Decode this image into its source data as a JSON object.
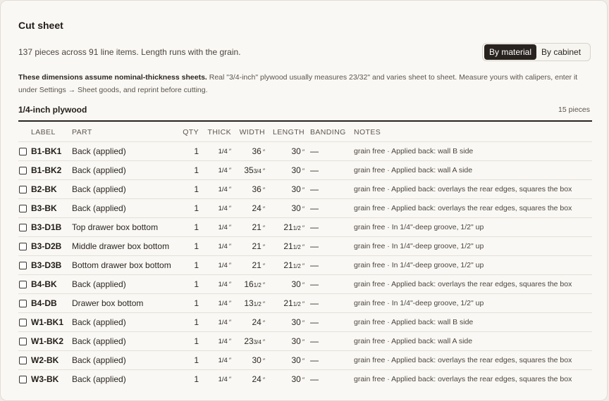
{
  "header": {
    "title": "Cut sheet",
    "summary": "137 pieces across 91 line items. Length runs with the grain.",
    "view_toggle": {
      "options": [
        "By material",
        "By cabinet"
      ],
      "selected": "By material"
    }
  },
  "note": {
    "bold": "These dimensions assume nominal-thickness sheets.",
    "text": " Real \"3/4-inch\" plywood usually measures 23/32\" and varies sheet to sheet. Measure yours with calipers, enter it under Settings → Sheet goods, and reprint before cutting."
  },
  "section": {
    "title": "1/4-inch plywood",
    "count": "15 pieces",
    "columns": [
      "LABEL",
      "PART",
      "QTY",
      "THICK",
      "WIDTH",
      "LENGTH",
      "BANDING",
      "NOTES"
    ],
    "rows": [
      {
        "label": "B1-BK1",
        "part": "Back (applied)",
        "qty": "1",
        "thick": "1/4",
        "width": {
          "w": "36",
          "f": ""
        },
        "length": {
          "w": "30",
          "f": ""
        },
        "banding": "—",
        "notes": "grain free · Applied back: wall B side"
      },
      {
        "label": "B1-BK2",
        "part": "Back (applied)",
        "qty": "1",
        "thick": "1/4",
        "width": {
          "w": "35",
          "f": "3/4"
        },
        "length": {
          "w": "30",
          "f": ""
        },
        "banding": "—",
        "notes": "grain free · Applied back: wall A side"
      },
      {
        "label": "B2-BK",
        "part": "Back (applied)",
        "qty": "1",
        "thick": "1/4",
        "width": {
          "w": "36",
          "f": ""
        },
        "length": {
          "w": "30",
          "f": ""
        },
        "banding": "—",
        "notes": "grain free · Applied back: overlays the rear edges, squares the box"
      },
      {
        "label": "B3-BK",
        "part": "Back (applied)",
        "qty": "1",
        "thick": "1/4",
        "width": {
          "w": "24",
          "f": ""
        },
        "length": {
          "w": "30",
          "f": ""
        },
        "banding": "—",
        "notes": "grain free · Applied back: overlays the rear edges, squares the box"
      },
      {
        "label": "B3-D1B",
        "part": "Top drawer box bottom",
        "qty": "1",
        "thick": "1/4",
        "width": {
          "w": "21",
          "f": ""
        },
        "length": {
          "w": "21",
          "f": "1/2"
        },
        "banding": "—",
        "notes": "grain free · In 1/4\"-deep groove, 1/2\" up"
      },
      {
        "label": "B3-D2B",
        "part": "Middle drawer box bottom",
        "qty": "1",
        "thick": "1/4",
        "width": {
          "w": "21",
          "f": ""
        },
        "length": {
          "w": "21",
          "f": "1/2"
        },
        "banding": "—",
        "notes": "grain free · In 1/4\"-deep groove, 1/2\" up"
      },
      {
        "label": "B3-D3B",
        "part": "Bottom drawer box bottom",
        "qty": "1",
        "thick": "1/4",
        "width": {
          "w": "21",
          "f": ""
        },
        "length": {
          "w": "21",
          "f": "1/2"
        },
        "banding": "—",
        "notes": "grain free · In 1/4\"-deep groove, 1/2\" up"
      },
      {
        "label": "B4-BK",
        "part": "Back (applied)",
        "qty": "1",
        "thick": "1/4",
        "width": {
          "w": "16",
          "f": "1/2"
        },
        "length": {
          "w": "30",
          "f": ""
        },
        "banding": "—",
        "notes": "grain free · Applied back: overlays the rear edges, squares the box"
      },
      {
        "label": "B4-DB",
        "part": "Drawer box bottom",
        "qty": "1",
        "thick": "1/4",
        "width": {
          "w": "13",
          "f": "1/2"
        },
        "length": {
          "w": "21",
          "f": "1/2"
        },
        "banding": "—",
        "notes": "grain free · In 1/4\"-deep groove, 1/2\" up"
      },
      {
        "label": "W1-BK1",
        "part": "Back (applied)",
        "qty": "1",
        "thick": "1/4",
        "width": {
          "w": "24",
          "f": ""
        },
        "length": {
          "w": "30",
          "f": ""
        },
        "banding": "—",
        "notes": "grain free · Applied back: wall B side"
      },
      {
        "label": "W1-BK2",
        "part": "Back (applied)",
        "qty": "1",
        "thick": "1/4",
        "width": {
          "w": "23",
          "f": "3/4"
        },
        "length": {
          "w": "30",
          "f": ""
        },
        "banding": "—",
        "notes": "grain free · Applied back: wall A side"
      },
      {
        "label": "W2-BK",
        "part": "Back (applied)",
        "qty": "1",
        "thick": "1/4",
        "width": {
          "w": "30",
          "f": ""
        },
        "length": {
          "w": "30",
          "f": ""
        },
        "banding": "—",
        "notes": "grain free · Applied back: overlays the rear edges, squares the box"
      },
      {
        "label": "W3-BK",
        "part": "Back (applied)",
        "qty": "1",
        "thick": "1/4",
        "width": {
          "w": "24",
          "f": ""
        },
        "length": {
          "w": "30",
          "f": ""
        },
        "banding": "—",
        "notes": "grain free · Applied back: overlays the rear edges, squares the box"
      }
    ]
  }
}
